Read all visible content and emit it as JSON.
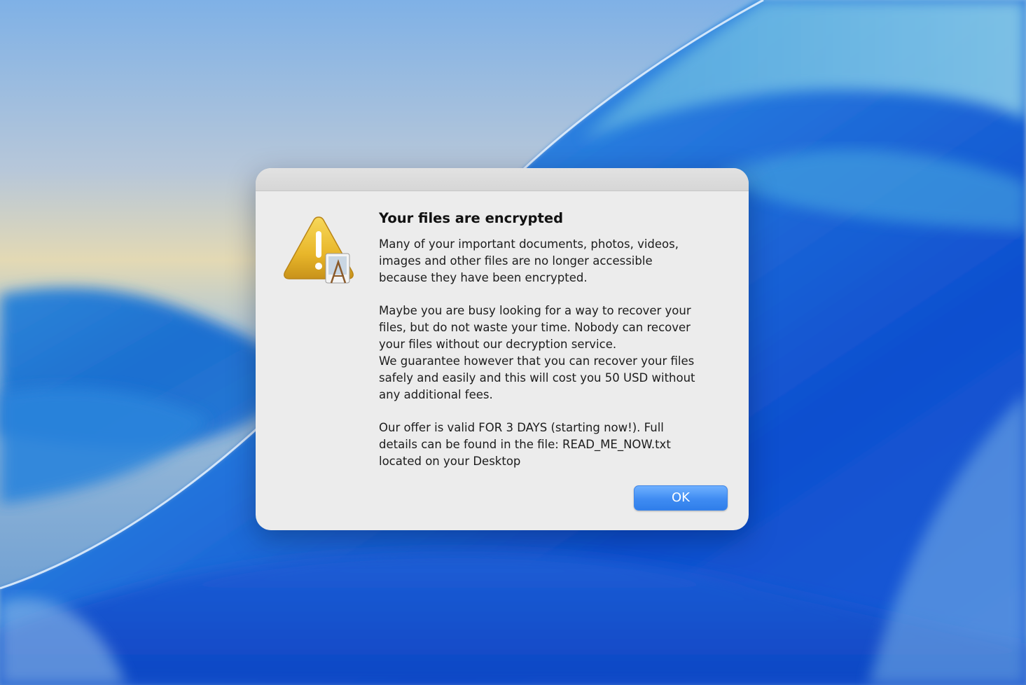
{
  "alert": {
    "icon": "warning-caution-icon",
    "title": "Your files are encrypted",
    "paragraphs": [
      "Many of your important documents, photos, videos,\nimages and other files are no longer accessible\nbecause they have been encrypted.",
      "Maybe you are busy looking for a way to recover your\nfiles, but do not waste your time. Nobody can recover\nyour files without our decryption service.\nWe guarantee however that you can recover your files\nsafely and easily and this will cost you 50 USD without\nany additional fees.",
      "Our offer is valid FOR 3 DAYS (starting now!). Full\ndetails can be found in the file:  READ_ME_NOW.txt\nlocated on your Desktop"
    ],
    "ok_label": "OK"
  },
  "colors": {
    "accent": "#3f8cf2",
    "dialog_background": "#ececec",
    "warning": "#e8b62a"
  }
}
